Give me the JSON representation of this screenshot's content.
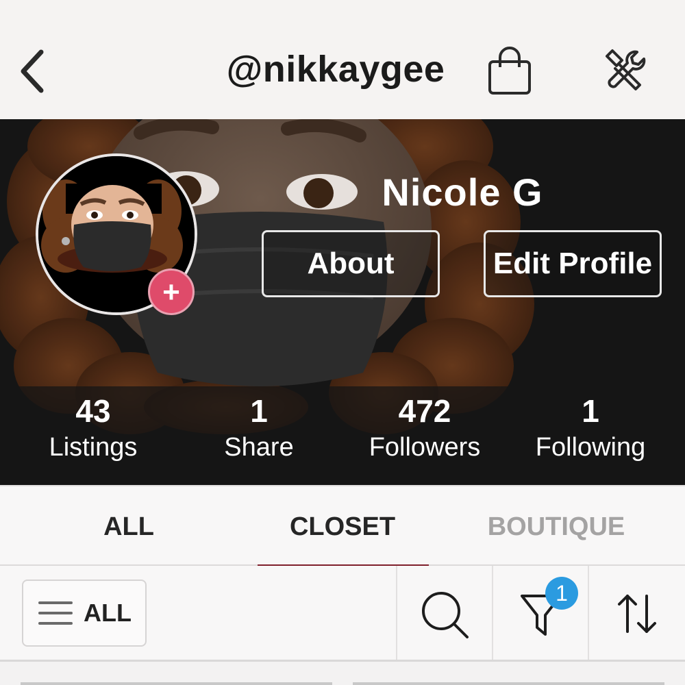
{
  "header": {
    "username": "@nikkaygee",
    "icons": [
      "back-arrow-icon",
      "shopping-bag-icon",
      "tools-icon"
    ]
  },
  "profile": {
    "name": "Nicole G",
    "about_label": "About",
    "edit_label": "Edit Profile",
    "add_icon": "+"
  },
  "stats": [
    {
      "value": "43",
      "label": "Listings"
    },
    {
      "value": "1",
      "label": "Share"
    },
    {
      "value": "472",
      "label": "Followers"
    },
    {
      "value": "1",
      "label": "Following"
    }
  ],
  "tabs": [
    {
      "label": "ALL",
      "state": "normal"
    },
    {
      "label": "CLOSET",
      "state": "active"
    },
    {
      "label": "BOUTIQUE",
      "state": "muted"
    }
  ],
  "toolbar": {
    "filter_label": "ALL",
    "filter_badge": "1",
    "icons": [
      "menu-lines-icon",
      "search-icon",
      "funnel-icon",
      "sort-icon"
    ]
  },
  "colors": {
    "accent_underline": "#7f1f2b",
    "plus_button": "#df4b6a",
    "badge": "#2b9be0",
    "muted_tab": "#a4a3a3"
  }
}
